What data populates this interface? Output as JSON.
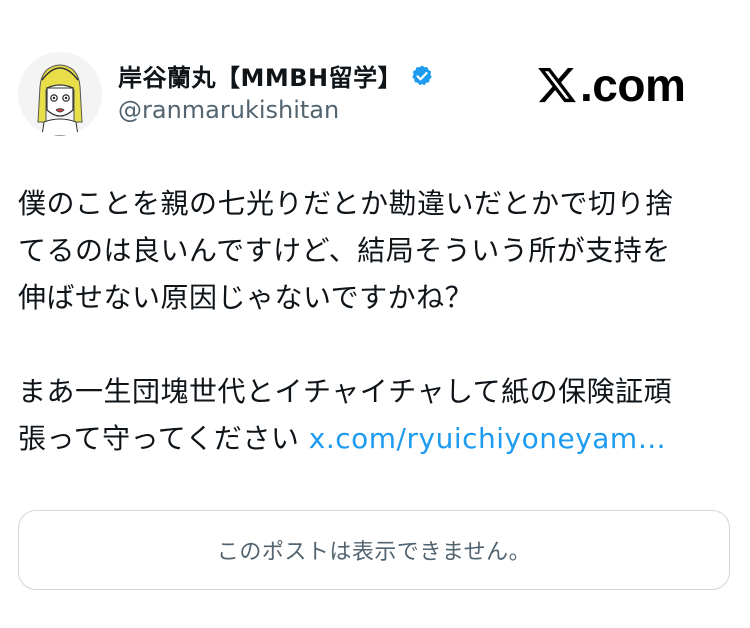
{
  "author": {
    "display_name": "岸谷蘭丸【MMBH留学】",
    "handle": "@ranmarukishitan",
    "verified": true,
    "verified_color": "#1d9bf0",
    "avatar_icon": "illustrated-avatar-icon"
  },
  "brand": {
    "logo_icon": "x-logo-icon",
    "text": ".com"
  },
  "tweet": {
    "lines": [
      "僕のことを親の七光りだとか勘違いだとかで切り捨",
      "てるのは良いんですけど、結局そういう所が支持を",
      "伸ばせない原因じゃないですかね？",
      "まあ一生団塊世代とイチャイチャして紙の保険証頑",
      "張って守ってください"
    ],
    "link_text": "x.com/ryuichiyoneyam…",
    "link_color": "#1d9bf0"
  },
  "quoted": {
    "unavailable_text": "このポストは表示できません。"
  }
}
